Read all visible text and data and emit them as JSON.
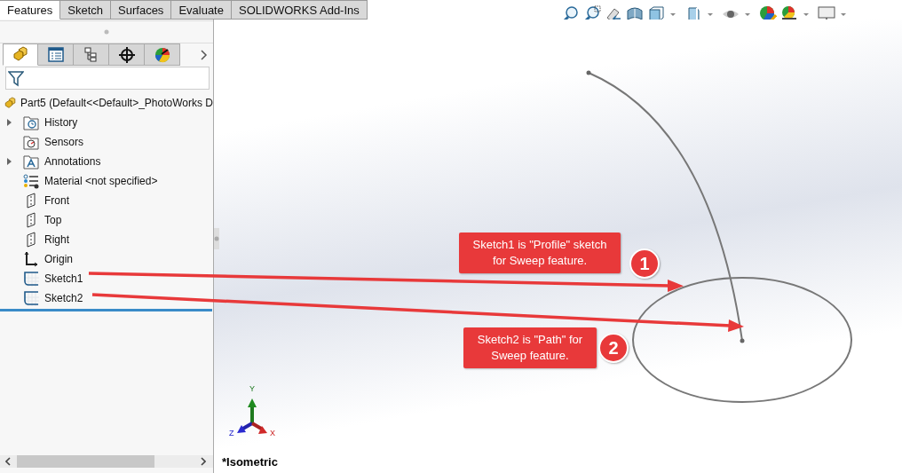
{
  "command_tabs": [
    {
      "label": "Features",
      "selected": true
    },
    {
      "label": "Sketch",
      "selected": false
    },
    {
      "label": "Surfaces",
      "selected": false
    },
    {
      "label": "Evaluate",
      "selected": false
    },
    {
      "label": "SOLIDWORKS Add-Ins",
      "selected": false
    }
  ],
  "panel_tabs": [
    {
      "kind": "features",
      "selected": true
    },
    {
      "kind": "properties",
      "selected": false
    },
    {
      "kind": "configurations",
      "selected": false
    },
    {
      "kind": "dimxpert",
      "selected": false
    },
    {
      "kind": "appearance",
      "selected": false
    }
  ],
  "tree": {
    "root": "Part5  (Default<<Default>_PhotoWorks D",
    "items": [
      {
        "label": "History",
        "kind": "history",
        "expandable": true
      },
      {
        "label": "Sensors",
        "kind": "sensors",
        "expandable": false
      },
      {
        "label": "Annotations",
        "kind": "annotations",
        "expandable": true
      },
      {
        "label": "Material <not specified>",
        "kind": "material",
        "expandable": false
      },
      {
        "label": "Front",
        "kind": "plane",
        "expandable": false
      },
      {
        "label": "Top",
        "kind": "plane",
        "expandable": false
      },
      {
        "label": "Right",
        "kind": "plane",
        "expandable": false
      },
      {
        "label": "Origin",
        "kind": "origin",
        "expandable": false
      },
      {
        "label": "Sketch1",
        "kind": "sketch",
        "expandable": false
      },
      {
        "label": "Sketch2",
        "kind": "sketch",
        "expandable": false
      }
    ]
  },
  "callouts": [
    {
      "text": "Sketch1 is \"Profile\" sketch for Sweep feature.",
      "number": "1"
    },
    {
      "text": "Sketch2 is \"Path\" for Sweep feature.",
      "number": "2"
    }
  ],
  "triad": {
    "x": "X",
    "y": "Y",
    "z": "Z"
  },
  "view_label": "*Isometric"
}
